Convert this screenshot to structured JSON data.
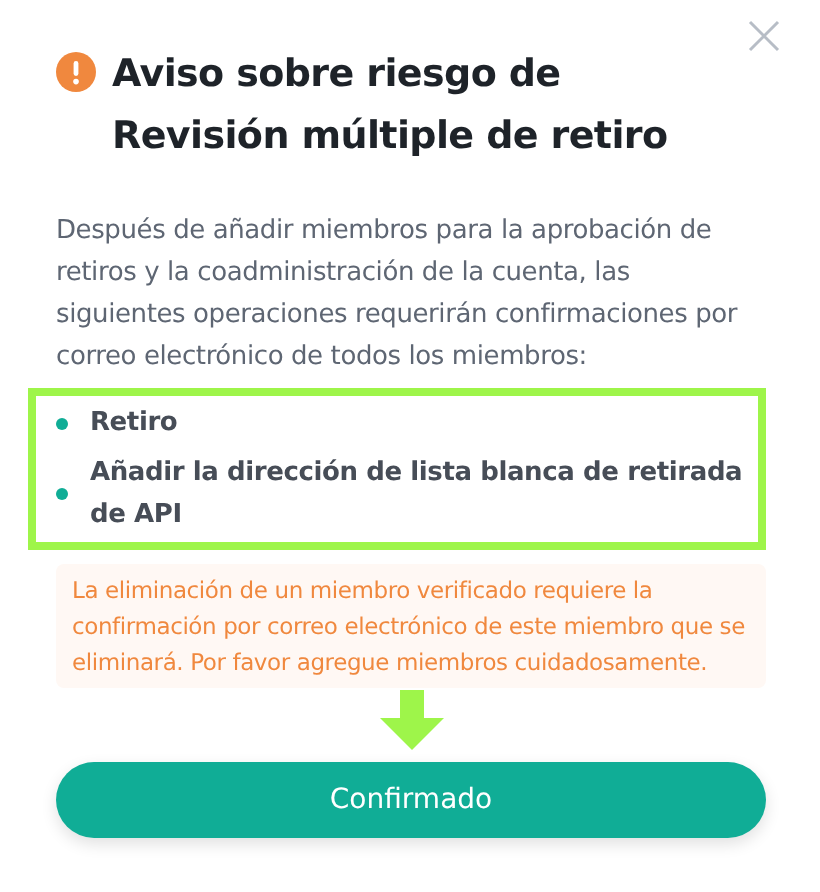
{
  "dialog": {
    "title": "Aviso sobre riesgo de Revisión múltiple de retiro",
    "intro": "Después de añadir miembros para la aprobación de retiros y la coadministración de la cuenta, las siguientes operaciones requerirán confirmaciones por correo electrónico de todos los miembros:",
    "operations": [
      {
        "label": "Retiro"
      },
      {
        "label": "Añadir la dirección de lista blanca de retirada de API"
      }
    ],
    "warning": "La eliminación de un miembro verificado requiere la confirmación por correo electrónico de este miembro que se eliminará. Por favor agregue miembros cuidadosamente.",
    "button": "Confirmado"
  }
}
